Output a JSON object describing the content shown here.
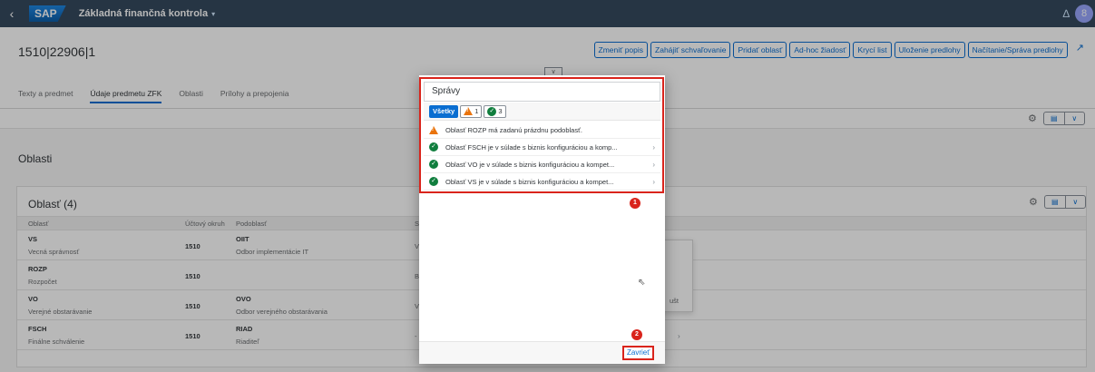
{
  "shell": {
    "back_glyph": "‹",
    "logo": "SAP",
    "app_title": "Základná finančná kontrola",
    "caret": "▾",
    "bell_icon": "bell-icon",
    "user_initial": "8"
  },
  "header": {
    "object_title": "1510|22906|1",
    "actions": [
      "Zmeniť popis",
      "Zahájiť schvaľovanie",
      "Pridať oblasť",
      "Ad-hoc žiadosť",
      "Krycí list",
      "Uloženie predlohy",
      "Načítanie/Správa predlohy"
    ],
    "tabs": [
      "Texty a predmet",
      "Údaje predmetu ZFK",
      "Oblasti",
      "Prílohy a prepojenia"
    ],
    "active_tab": 1
  },
  "section": {
    "title": "Oblasti"
  },
  "table": {
    "title": "Oblasť (4)",
    "columns": [
      "Oblasť",
      "Účtový okruh",
      "Podoblasť",
      "S"
    ],
    "rows": [
      {
        "code": "VS",
        "name": "Vecná správnosť",
        "okruh": "1510",
        "pcode": "OIIT",
        "pname": "Odbor implementácie IT",
        "s": "V"
      },
      {
        "code": "ROZP",
        "name": "Rozpočet",
        "okruh": "1510",
        "pcode": "",
        "pname": "",
        "s": "B"
      },
      {
        "code": "VO",
        "name": "Verejné obstarávanie",
        "okruh": "1510",
        "pcode": "OVO",
        "pname": "Odbor verejného obstarávania",
        "s": "V"
      },
      {
        "code": "FSCH",
        "name": "Finálne schválenie",
        "okruh": "1510",
        "pcode": "RIAD",
        "pname": "Riaditeľ",
        "s": "-"
      }
    ]
  },
  "popover": {
    "fragment": "ušt"
  },
  "dialog": {
    "title": "Správy",
    "filters": {
      "all": "Všetky",
      "warning_count": "1",
      "success_count": "3"
    },
    "messages": [
      {
        "type": "warning",
        "text": "Oblasť ROZP má zadanú prázdnu podoblasť.",
        "chevron": false
      },
      {
        "type": "success",
        "text": "Oblasť FSCH je v súlade s biznis konfiguráciou a komp...",
        "chevron": true
      },
      {
        "type": "success",
        "text": "Oblasť VO je v súlade s biznis konfiguráciou a kompet...",
        "chevron": true
      },
      {
        "type": "success",
        "text": "Oblasť VS je v súlade s biznis konfiguráciou a kompet...",
        "chevron": true
      }
    ],
    "close_label": "Zavrieť",
    "badges": [
      "1",
      "2"
    ]
  },
  "colors": {
    "shell": "#354a5f",
    "accent": "#0a6ed1",
    "warning": "#e9730c",
    "success": "#107e3e",
    "highlight": "#d9241c"
  }
}
